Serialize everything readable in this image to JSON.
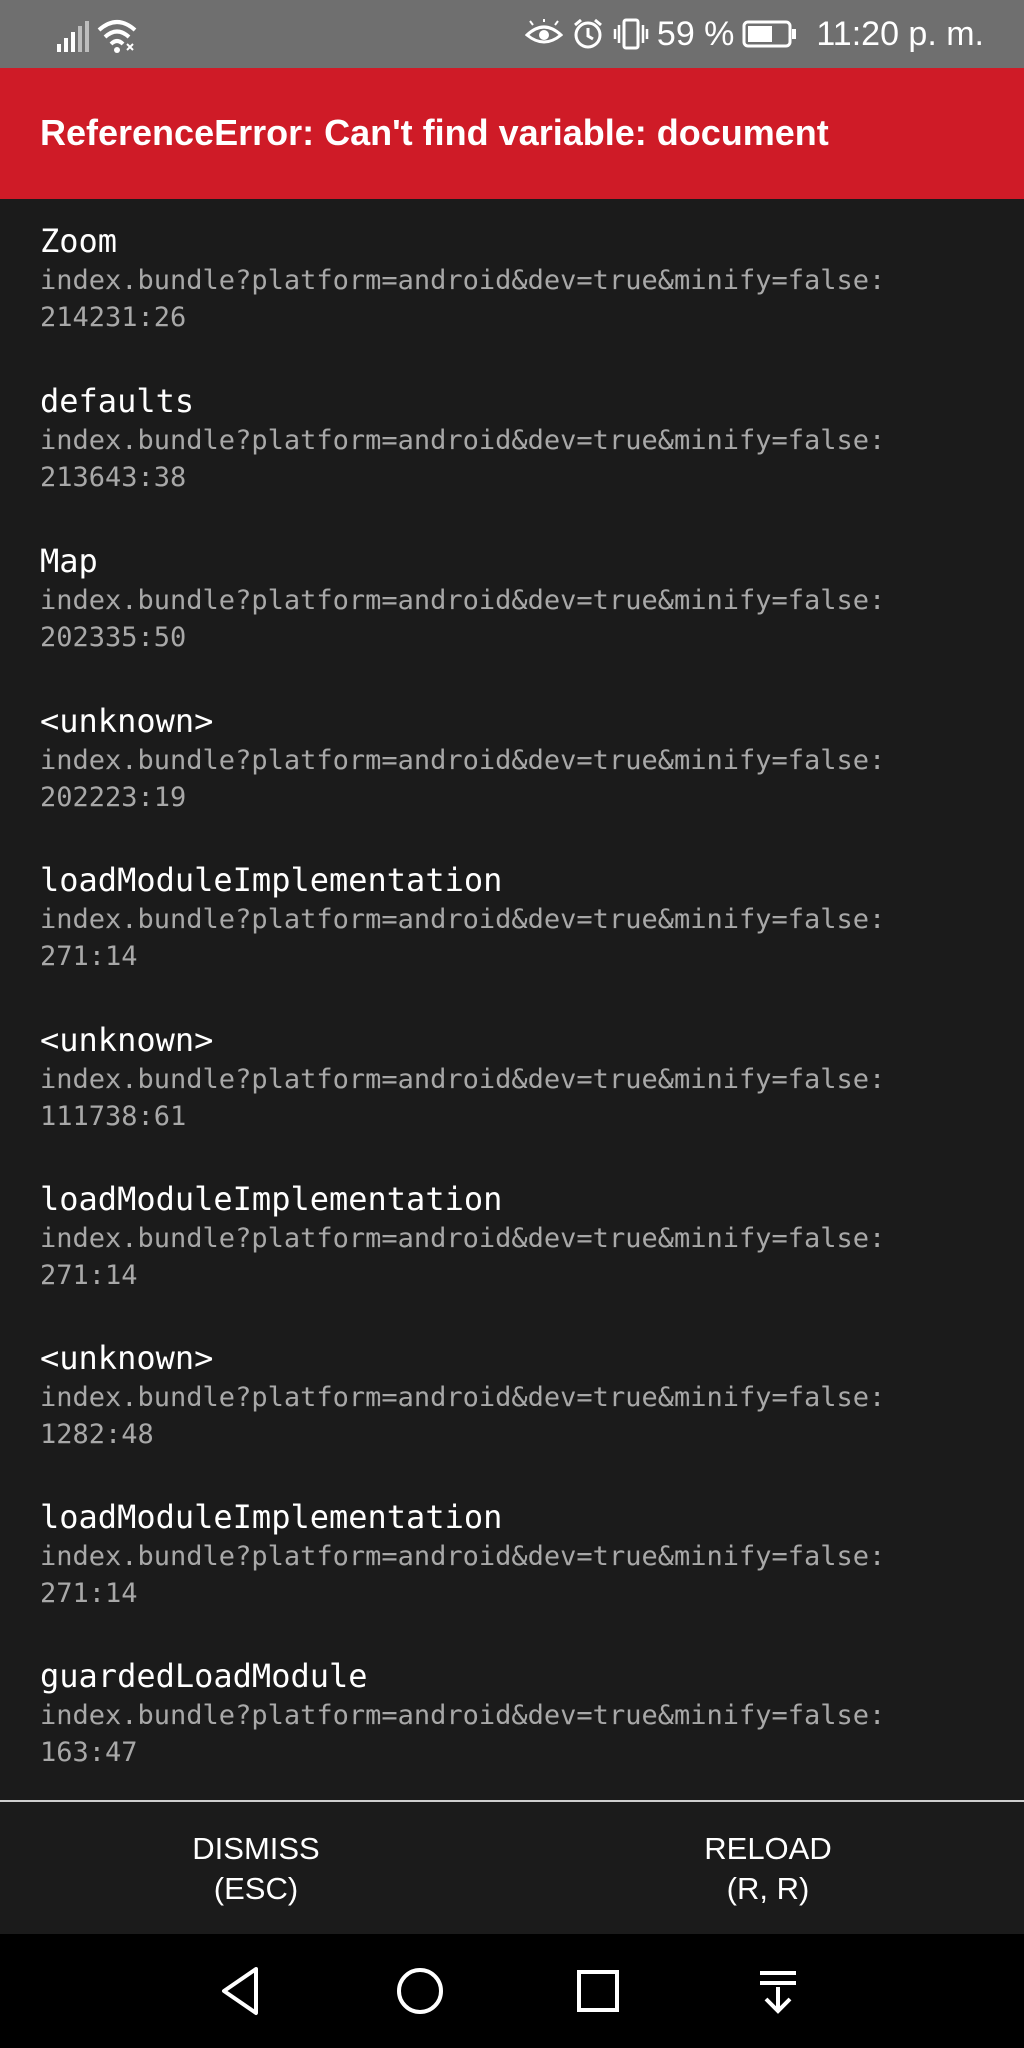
{
  "status_bar": {
    "battery_percent": "59 %",
    "time": "11:20 p. m.",
    "icons": [
      "signal-icon",
      "wifi-icon",
      "eye-comfort-icon",
      "alarm-icon",
      "vibrate-icon",
      "battery-icon"
    ]
  },
  "error": {
    "title": "ReferenceError: Can't find variable: document",
    "accent_color": "#cf1b27"
  },
  "stack_frames": [
    {
      "name": "Zoom",
      "location": "index.bundle?platform=android&dev=true&minify=false:",
      "line": "214231:26"
    },
    {
      "name": "defaults",
      "location": "index.bundle?platform=android&dev=true&minify=false:",
      "line": "213643:38"
    },
    {
      "name": "Map",
      "location": "index.bundle?platform=android&dev=true&minify=false:",
      "line": "202335:50"
    },
    {
      "name": "<unknown>",
      "location": "index.bundle?platform=android&dev=true&minify=false:",
      "line": "202223:19"
    },
    {
      "name": "loadModuleImplementation",
      "location": "index.bundle?platform=android&dev=true&minify=false:",
      "line": "271:14"
    },
    {
      "name": "<unknown>",
      "location": "index.bundle?platform=android&dev=true&minify=false:",
      "line": "111738:61"
    },
    {
      "name": "loadModuleImplementation",
      "location": "index.bundle?platform=android&dev=true&minify=false:",
      "line": "271:14"
    },
    {
      "name": "<unknown>",
      "location": "index.bundle?platform=android&dev=true&minify=false:",
      "line": "1282:48"
    },
    {
      "name": "loadModuleImplementation",
      "location": "index.bundle?platform=android&dev=true&minify=false:",
      "line": "271:14"
    },
    {
      "name": "guardedLoadModule",
      "location": "index.bundle?platform=android&dev=true&minify=false:",
      "line": "163:47"
    }
  ],
  "footer": {
    "dismiss_label": "DISMISS",
    "dismiss_shortcut": "(ESC)",
    "reload_label": "RELOAD",
    "reload_shortcut": "(R, R)"
  },
  "nav_bar": {
    "icons": [
      "back-icon",
      "home-icon",
      "recents-icon",
      "notification-pulldown-icon"
    ]
  }
}
